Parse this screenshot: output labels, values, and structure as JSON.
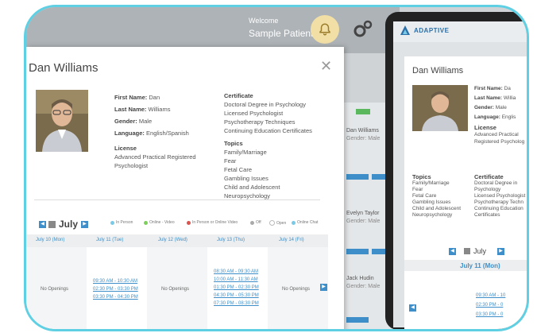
{
  "header": {
    "welcome": "Welcome",
    "user": "Sample Patient"
  },
  "modal": {
    "title": "Dan Williams",
    "close": "✕",
    "first_name_label": "First Name:",
    "first_name": "Dan",
    "last_name_label": "Last Name:",
    "last_name": "Williams",
    "gender_label": "Gender:",
    "gender": "Male",
    "language_label": "Language:",
    "language": "English/Spanish",
    "license_label": "License",
    "license": [
      "Advanced Practical Registered",
      "Psychologist"
    ],
    "certificate_label": "Certificate",
    "certificates": [
      "Doctoral Degree in Psychology",
      "Licensed Psychologist",
      "Psychotherapy Techniques",
      "Continuing Education Certificates"
    ],
    "topics_label": "Topics",
    "topics": [
      "Family/Marriage",
      "Fear",
      "Fetal Care",
      "Gambling Issues",
      "Child and Adolescent",
      "Neuropsychology"
    ]
  },
  "calendar": {
    "month": "July",
    "legend": [
      "In Person",
      "Online - Video",
      "In Person or Online Video",
      "Off",
      "Open",
      "Online Chat"
    ],
    "legend_colors": [
      "#7ac9e6",
      "#7ccf5a",
      "#d9534f",
      "#aaaaaa",
      "#ffffff",
      "#7ac9e6"
    ],
    "days": [
      "July 10 (Mon)",
      "July 11 (Tue)",
      "July 12 (Wed)",
      "July 13 (Thu)",
      "July 14 (Fri)"
    ],
    "no_openings": "No Openings",
    "tue_slots": [
      "09:30 AM - 10:30 AM",
      "02:30 PM - 03:30 PM",
      "03:30 PM - 04:30 PM"
    ],
    "thu_slots": [
      "08:30 AM - 09:30 AM",
      "10:00 AM - 11:30 AM",
      "01:30 PM - 02:30 PM",
      "04:30 PM - 05:30 PM",
      "07:30 PM - 08:30 PM"
    ]
  },
  "background_list": {
    "names": [
      "Dan Williams",
      "Evelyn Taylor",
      "Jack Hudin"
    ],
    "meta_label": "Gender: Male"
  },
  "mobile": {
    "brand": "ADAPTIVE",
    "title": "Dan Williams",
    "first_name_label": "First Name:",
    "first_name": "Da",
    "last_name_label": "Last Name:",
    "last_name": "Willia",
    "gender_label": "Gender:",
    "gender": "Male",
    "language_label": "Language:",
    "language": "Englis",
    "license_label": "License",
    "license": [
      "Advanced Practical",
      "Registered Psycholog"
    ],
    "topics_label": "Topics",
    "topics": [
      "Family/Marriage",
      "Fear",
      "Fetal Care",
      "Gambling Issues",
      "Child and Adolescent",
      "Neuropsychology"
    ],
    "certificate_label": "Certificate",
    "certificates": [
      "Doctoral Degree in",
      "Psychology",
      "Licensed Psychologist",
      "Psychotherapy Techn",
      "Continuing Education",
      "Certificates"
    ],
    "month": "July",
    "day": "July 11 (Mon)",
    "slots": [
      "09:30 AM - 10",
      "02:30 PM - 0",
      "03:30 PM - 0"
    ]
  }
}
